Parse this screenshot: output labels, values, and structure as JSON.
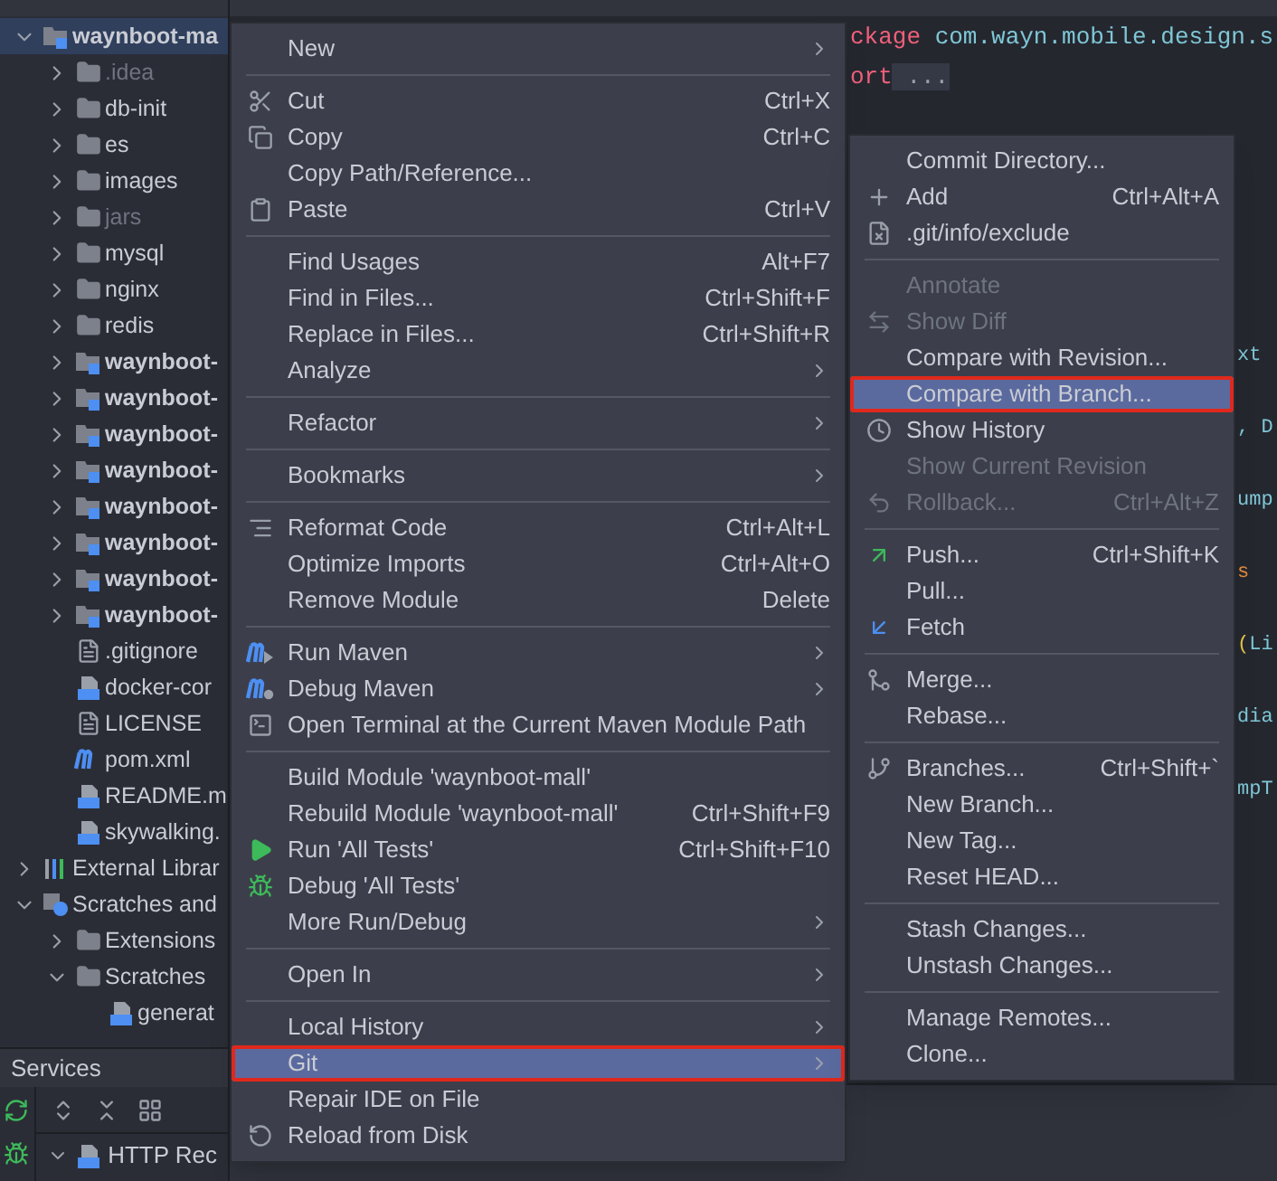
{
  "project_tree": [
    {
      "label": "waynboot-ma",
      "kind": "module",
      "expanded": true,
      "dimmed": false,
      "selected": true,
      "children": [
        {
          "label": ".idea",
          "kind": "folder",
          "expanded": false,
          "dimmed": true,
          "selected": false
        },
        {
          "label": "db-init",
          "kind": "folder",
          "expanded": false,
          "dimmed": false,
          "selected": false
        },
        {
          "label": "es",
          "kind": "folder",
          "expanded": false,
          "dimmed": false,
          "selected": false
        },
        {
          "label": "images",
          "kind": "folder",
          "expanded": false,
          "dimmed": false,
          "selected": false
        },
        {
          "label": "jars",
          "kind": "folder",
          "expanded": false,
          "dimmed": true,
          "selected": false
        },
        {
          "label": "mysql",
          "kind": "folder",
          "expanded": false,
          "dimmed": false,
          "selected": false
        },
        {
          "label": "nginx",
          "kind": "folder",
          "expanded": false,
          "dimmed": false,
          "selected": false
        },
        {
          "label": "redis",
          "kind": "folder",
          "expanded": false,
          "dimmed": false,
          "selected": false
        },
        {
          "label": "waynboot-",
          "kind": "module",
          "expanded": false,
          "dimmed": false,
          "selected": false
        },
        {
          "label": "waynboot-",
          "kind": "module",
          "expanded": false,
          "dimmed": false,
          "selected": false
        },
        {
          "label": "waynboot-",
          "kind": "module",
          "expanded": false,
          "dimmed": false,
          "selected": false
        },
        {
          "label": "waynboot-",
          "kind": "module",
          "expanded": false,
          "dimmed": false,
          "selected": false
        },
        {
          "label": "waynboot-",
          "kind": "module",
          "expanded": false,
          "dimmed": false,
          "selected": false
        },
        {
          "label": "waynboot-",
          "kind": "module",
          "expanded": false,
          "dimmed": false,
          "selected": false
        },
        {
          "label": "waynboot-",
          "kind": "module",
          "expanded": false,
          "dimmed": false,
          "selected": false
        },
        {
          "label": "waynboot-",
          "kind": "module",
          "expanded": false,
          "dimmed": false,
          "selected": false
        },
        {
          "label": ".gitignore",
          "kind": "ignore-file",
          "dimmed": false,
          "selected": false
        },
        {
          "label": "docker-cor",
          "kind": "dc-file",
          "dimmed": false,
          "selected": false
        },
        {
          "label": "LICENSE",
          "kind": "text-file",
          "dimmed": false,
          "selected": false
        },
        {
          "label": "pom.xml",
          "kind": "maven-file",
          "dimmed": false,
          "selected": false
        },
        {
          "label": "README.m",
          "kind": "md-file",
          "dimmed": false,
          "selected": false
        },
        {
          "label": "skywalking.",
          "kind": "dc-file",
          "dimmed": false,
          "selected": false
        }
      ]
    },
    {
      "label": "External Librar",
      "kind": "library",
      "expanded": false,
      "dimmed": false,
      "selected": false
    },
    {
      "label": "Scratches and",
      "kind": "scratches",
      "expanded": true,
      "dimmed": false,
      "selected": false,
      "children": [
        {
          "label": "Extensions",
          "kind": "folder",
          "expanded": false,
          "dimmed": false,
          "selected": false
        },
        {
          "label": "Scratches",
          "kind": "folder",
          "expanded": true,
          "dimmed": false,
          "selected": false,
          "children": [
            {
              "label": "generat",
              "kind": "api-file",
              "dimmed": false,
              "selected": false
            }
          ]
        }
      ]
    }
  ],
  "services": {
    "title": "Services",
    "rows": [
      {
        "label": "HTTP Rec",
        "expanded": true
      }
    ]
  },
  "editor": {
    "top_lines": [
      [
        {
          "text": "ckage",
          "kind": "keyword"
        },
        {
          "text": " com.wayn.mobile.design.s",
          "kind": "plain"
        }
      ],
      [
        {
          "text": "ort",
          "kind": "keyword"
        },
        {
          "text": " ...",
          "kind": "folded"
        }
      ]
    ],
    "edge_lines": [
      [
        {
          "text": "xt",
          "kind": "plain"
        }
      ],
      [
        {
          "text": ", D",
          "kind": "plain"
        }
      ],
      [
        {
          "text": "ump",
          "kind": "plain"
        }
      ],
      [
        {
          "text": "s",
          "kind": "string"
        }
      ],
      [
        {
          "text": "(",
          "kind": "bracket"
        },
        {
          "text": "Li",
          "kind": "plain"
        }
      ],
      [
        {
          "text": "dia",
          "kind": "plain"
        }
      ],
      [
        {
          "text": "mpT",
          "kind": "plain"
        }
      ]
    ]
  },
  "context_menu": [
    {
      "kind": "plain",
      "label": "New",
      "submenu": true,
      "selected": false,
      "annotated": false
    },
    {
      "kind": "separator"
    },
    {
      "kind": "scissors",
      "label": "Cut",
      "shortcut": "Ctrl+X",
      "submenu": false,
      "selected": false,
      "annotated": false
    },
    {
      "kind": "copy",
      "label": "Copy",
      "shortcut": "Ctrl+C",
      "submenu": false,
      "selected": false,
      "annotated": false
    },
    {
      "kind": "plain",
      "label": "Copy Path/Reference...",
      "submenu": false,
      "selected": false,
      "annotated": false
    },
    {
      "kind": "clipboard",
      "label": "Paste",
      "shortcut": "Ctrl+V",
      "submenu": false,
      "selected": false,
      "annotated": false
    },
    {
      "kind": "separator"
    },
    {
      "kind": "plain",
      "label": "Find Usages",
      "shortcut": "Alt+F7",
      "submenu": false,
      "selected": false,
      "annotated": false
    },
    {
      "kind": "plain",
      "label": "Find in Files...",
      "shortcut": "Ctrl+Shift+F",
      "submenu": false,
      "selected": false,
      "annotated": false
    },
    {
      "kind": "plain",
      "label": "Replace in Files...",
      "shortcut": "Ctrl+Shift+R",
      "submenu": false,
      "selected": false,
      "annotated": false
    },
    {
      "kind": "plain",
      "label": "Analyze",
      "submenu": true,
      "selected": false,
      "annotated": false
    },
    {
      "kind": "separator"
    },
    {
      "kind": "plain",
      "label": "Refactor",
      "submenu": true,
      "selected": false,
      "annotated": false
    },
    {
      "kind": "separator"
    },
    {
      "kind": "plain",
      "label": "Bookmarks",
      "submenu": true,
      "selected": false,
      "annotated": false
    },
    {
      "kind": "separator"
    },
    {
      "kind": "reformat",
      "label": "Reformat Code",
      "shortcut": "Ctrl+Alt+L",
      "submenu": false,
      "selected": false,
      "annotated": false
    },
    {
      "kind": "plain",
      "label": "Optimize Imports",
      "shortcut": "Ctrl+Alt+O",
      "submenu": false,
      "selected": false,
      "annotated": false
    },
    {
      "kind": "plain",
      "label": "Remove Module",
      "shortcut": "Delete",
      "submenu": false,
      "selected": false,
      "annotated": false
    },
    {
      "kind": "separator"
    },
    {
      "kind": "maven-run",
      "label": "Run Maven",
      "submenu": true,
      "selected": false,
      "annotated": false
    },
    {
      "kind": "maven-debug",
      "label": "Debug Maven",
      "submenu": true,
      "selected": false,
      "annotated": false
    },
    {
      "kind": "terminal",
      "label": "Open Terminal at the Current Maven Module Path",
      "submenu": false,
      "selected": false,
      "annotated": false
    },
    {
      "kind": "separator"
    },
    {
      "kind": "plain",
      "label": "Build Module 'waynboot-mall'",
      "submenu": false,
      "selected": false,
      "annotated": false
    },
    {
      "kind": "plain",
      "label": "Rebuild Module 'waynboot-mall'",
      "shortcut": "Ctrl+Shift+F9",
      "submenu": false,
      "selected": false,
      "annotated": false
    },
    {
      "kind": "run",
      "label": "Run 'All Tests'",
      "shortcut": "Ctrl+Shift+F10",
      "submenu": false,
      "selected": false,
      "annotated": false
    },
    {
      "kind": "debug",
      "label": "Debug 'All Tests'",
      "submenu": false,
      "selected": false,
      "annotated": false
    },
    {
      "kind": "plain",
      "label": "More Run/Debug",
      "submenu": true,
      "selected": false,
      "annotated": false
    },
    {
      "kind": "separator"
    },
    {
      "kind": "plain",
      "label": "Open In",
      "submenu": true,
      "selected": false,
      "annotated": false
    },
    {
      "kind": "separator"
    },
    {
      "kind": "plain",
      "label": "Local History",
      "submenu": true,
      "selected": false,
      "annotated": false
    },
    {
      "kind": "plain",
      "label": "Git",
      "submenu": true,
      "selected": true,
      "annotated": true
    },
    {
      "kind": "plain",
      "label": "Repair IDE on File",
      "submenu": false,
      "selected": false,
      "annotated": false
    },
    {
      "kind": "reload",
      "label": "Reload from Disk",
      "submenu": false,
      "selected": false,
      "annotated": false
    }
  ],
  "git_submenu": [
    {
      "kind": "plain",
      "label": "Commit Directory...",
      "disabled": false,
      "selected": false,
      "annotated": false
    },
    {
      "kind": "plus",
      "label": "Add",
      "shortcut": "Ctrl+Alt+A",
      "disabled": false,
      "selected": false,
      "annotated": false
    },
    {
      "kind": "excluded-file",
      "label": ".git/info/exclude",
      "disabled": false,
      "selected": false,
      "annotated": false
    },
    {
      "kind": "separator"
    },
    {
      "kind": "plain",
      "label": "Annotate",
      "disabled": true,
      "selected": false,
      "annotated": false
    },
    {
      "kind": "diff",
      "label": "Show Diff",
      "disabled": true,
      "selected": false,
      "annotated": false
    },
    {
      "kind": "plain",
      "label": "Compare with Revision...",
      "disabled": false,
      "selected": false,
      "annotated": false
    },
    {
      "kind": "plain",
      "label": "Compare with Branch...",
      "disabled": false,
      "selected": true,
      "annotated": true
    },
    {
      "kind": "clock",
      "label": "Show History",
      "disabled": false,
      "selected": false,
      "annotated": false
    },
    {
      "kind": "plain",
      "label": "Show Current Revision",
      "disabled": true,
      "selected": false,
      "annotated": false
    },
    {
      "kind": "undo",
      "label": "Rollback...",
      "shortcut": "Ctrl+Alt+Z",
      "disabled": true,
      "selected": false,
      "annotated": false
    },
    {
      "kind": "separator"
    },
    {
      "kind": "push",
      "label": "Push...",
      "shortcut": "Ctrl+Shift+K",
      "disabled": false,
      "selected": false,
      "annotated": false
    },
    {
      "kind": "plain",
      "label": "Pull...",
      "disabled": false,
      "selected": false,
      "annotated": false
    },
    {
      "kind": "fetch",
      "label": "Fetch",
      "disabled": false,
      "selected": false,
      "annotated": false
    },
    {
      "kind": "separator"
    },
    {
      "kind": "merge",
      "label": "Merge...",
      "disabled": false,
      "selected": false,
      "annotated": false
    },
    {
      "kind": "plain",
      "label": "Rebase...",
      "disabled": false,
      "selected": false,
      "annotated": false
    },
    {
      "kind": "separator"
    },
    {
      "kind": "branch",
      "label": "Branches...",
      "shortcut": "Ctrl+Shift+`",
      "disabled": false,
      "selected": false,
      "annotated": false
    },
    {
      "kind": "plain",
      "label": "New Branch...",
      "disabled": false,
      "selected": false,
      "annotated": false
    },
    {
      "kind": "plain",
      "label": "New Tag...",
      "disabled": false,
      "selected": false,
      "annotated": false
    },
    {
      "kind": "plain",
      "label": "Reset HEAD...",
      "disabled": false,
      "selected": false,
      "annotated": false
    },
    {
      "kind": "separator"
    },
    {
      "kind": "plain",
      "label": "Stash Changes...",
      "disabled": false,
      "selected": false,
      "annotated": false
    },
    {
      "kind": "plain",
      "label": "Unstash Changes...",
      "disabled": false,
      "selected": false,
      "annotated": false
    },
    {
      "kind": "separator"
    },
    {
      "kind": "plain",
      "label": "Manage Remotes...",
      "disabled": false,
      "selected": false,
      "annotated": false
    },
    {
      "kind": "plain",
      "label": "Clone...",
      "disabled": false,
      "selected": false,
      "annotated": false
    }
  ]
}
